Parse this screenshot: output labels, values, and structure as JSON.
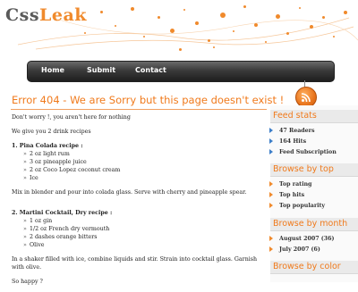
{
  "logo": {
    "part1": "Css",
    "part2": "Leak"
  },
  "nav": {
    "items": [
      "Home",
      "Submit",
      "Contact"
    ]
  },
  "flags": [
    [
      "#0033a0",
      "#ffffff",
      "#e4002b"
    ],
    [
      "#012169",
      "#ffffff",
      "#c8102e"
    ],
    [
      "#ffffff",
      "#e4002b",
      "#ffffff"
    ]
  ],
  "main": {
    "title": "Error 404 - We are Sorry but this page doesn't exist !",
    "intro": "Don't worry !, you aren't here for nothing",
    "give": "We give you 2 drink recipes",
    "recipe1": {
      "heading": "1. Pina Colada recipe :",
      "ingredients": [
        "2 oz light rum",
        "3 oz pineapple juice",
        "2 oz Coco Lopez coconut cream",
        "Ice"
      ],
      "instructions": "Mix in blender and pour into colada glass. Serve with cherry and pineapple spear."
    },
    "recipe2": {
      "heading": "2. Martini Cocktail, Dry recipe :",
      "ingredients": [
        "1 oz gin",
        "1/2 oz French dry vermouth",
        "2 dashes orange bitters",
        "Olive"
      ],
      "instructions": "In a shaker filled with ice, combine liquids and stir. Strain into cocktail glass. Garnish with olive."
    },
    "closing": "So happy ?"
  },
  "sidebar": {
    "feed_stats": {
      "title": "Feed stats",
      "items": [
        "47 Readers",
        "164 Hits",
        "Feed Subscription"
      ]
    },
    "browse_top": {
      "title": "Browse by top",
      "items": [
        "Top rating",
        "Top hits",
        "Top popularity"
      ]
    },
    "browse_month": {
      "title": "Browse by month",
      "items": [
        "August 2007 (36)",
        "July 2007 (6)"
      ]
    },
    "browse_color": {
      "title": "Browse by color"
    }
  },
  "colors": {
    "accent": "#f07a1c",
    "nav_dark": "#2a2a2a",
    "bullet_blue": "#3c7ec8"
  }
}
